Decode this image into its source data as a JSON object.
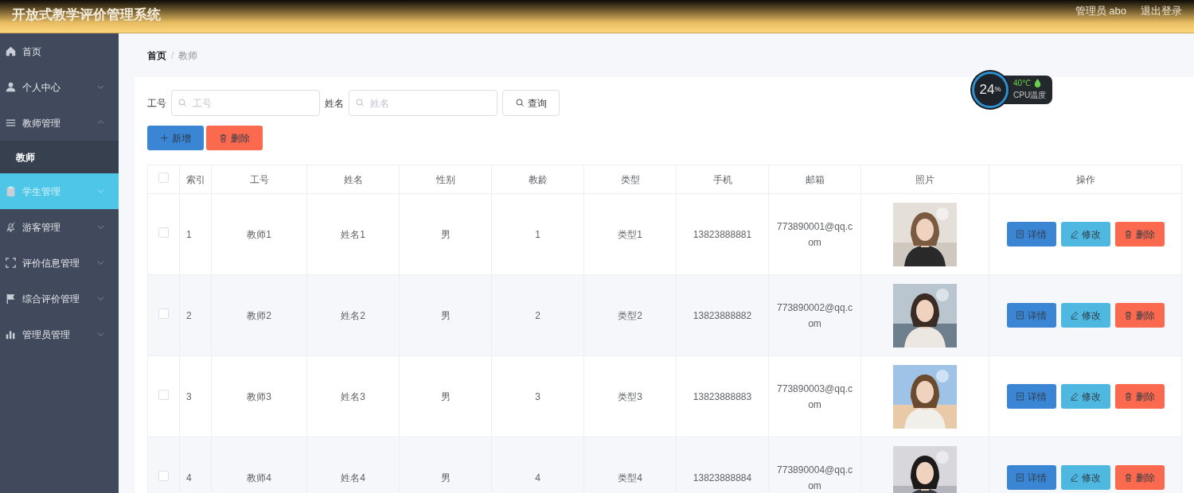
{
  "header": {
    "title": "开放式教学评价管理系统",
    "user": "管理员 abo",
    "logout": "退出登录"
  },
  "sidebar": {
    "items": [
      {
        "label": "首页",
        "expandable": false,
        "hovered": false
      },
      {
        "label": "个人中心",
        "expandable": true,
        "expanded": false,
        "hovered": false
      },
      {
        "label": "教师管理",
        "expandable": true,
        "expanded": true,
        "hovered": false,
        "children": [
          {
            "label": "教师",
            "selected": true
          }
        ]
      },
      {
        "label": "学生管理",
        "expandable": true,
        "expanded": false,
        "hovered": true
      },
      {
        "label": "游客管理",
        "expandable": true,
        "expanded": false,
        "hovered": false
      },
      {
        "label": "评价信息管理",
        "expandable": true,
        "expanded": false,
        "hovered": false
      },
      {
        "label": "综合评价管理",
        "expandable": true,
        "expanded": false,
        "hovered": false
      },
      {
        "label": "管理员管理",
        "expandable": true,
        "expanded": false,
        "hovered": false
      }
    ]
  },
  "breadcrumb_separator": "/",
  "breadcrumb": [
    {
      "label": "首页",
      "current": false
    },
    {
      "label": "教师",
      "current": true
    }
  ],
  "cpu_widget": {
    "usage": "24",
    "unit": "%",
    "temperature": "40℃",
    "label": "CPU温度"
  },
  "search": {
    "fields": [
      {
        "label": "工号",
        "placeholder": "工号"
      },
      {
        "label": "姓名",
        "placeholder": "姓名"
      }
    ],
    "button": "查询"
  },
  "toolbar": [
    {
      "label": "新增",
      "kind": "add"
    },
    {
      "label": "删除",
      "kind": "delete"
    }
  ],
  "table": {
    "select_all": {
      "checked": false
    },
    "columns": [
      "索引",
      "工号",
      "姓名",
      "性别",
      "教龄",
      "类型",
      "手机",
      "邮箱",
      "照片",
      "操作"
    ],
    "rows": [
      {
        "checked": false,
        "cells": [
          "1",
          "教师1",
          "姓名1",
          "男",
          "1",
          "类型1",
          "13823888881",
          "773890001@qq.com"
        ],
        "photo": {
          "kind": "picture"
        },
        "actions": [
          {
            "label": "详情",
            "kind": "detail"
          },
          {
            "label": "修改",
            "kind": "edit"
          },
          {
            "label": "删除",
            "kind": "delete"
          }
        ]
      },
      {
        "checked": false,
        "cells": [
          "2",
          "教师2",
          "姓名2",
          "男",
          "2",
          "类型2",
          "13823888882",
          "773890002@qq.com"
        ],
        "photo": {
          "kind": "picture"
        },
        "actions": [
          {
            "label": "详情",
            "kind": "detail"
          },
          {
            "label": "修改",
            "kind": "edit"
          },
          {
            "label": "删除",
            "kind": "delete"
          }
        ]
      },
      {
        "checked": false,
        "cells": [
          "3",
          "教师3",
          "姓名3",
          "男",
          "3",
          "类型3",
          "13823888883",
          "773890003@qq.com"
        ],
        "photo": {
          "kind": "picture"
        },
        "actions": [
          {
            "label": "详情",
            "kind": "detail"
          },
          {
            "label": "修改",
            "kind": "edit"
          },
          {
            "label": "删除",
            "kind": "delete"
          }
        ]
      },
      {
        "checked": false,
        "cells": [
          "4",
          "教师4",
          "姓名4",
          "男",
          "4",
          "类型4",
          "13823888884",
          "773890004@qq.com"
        ],
        "photo": {
          "kind": "picture"
        },
        "actions": [
          {
            "label": "详情",
            "kind": "detail"
          },
          {
            "label": "修改",
            "kind": "edit"
          },
          {
            "label": "删除",
            "kind": "delete"
          }
        ]
      }
    ]
  }
}
